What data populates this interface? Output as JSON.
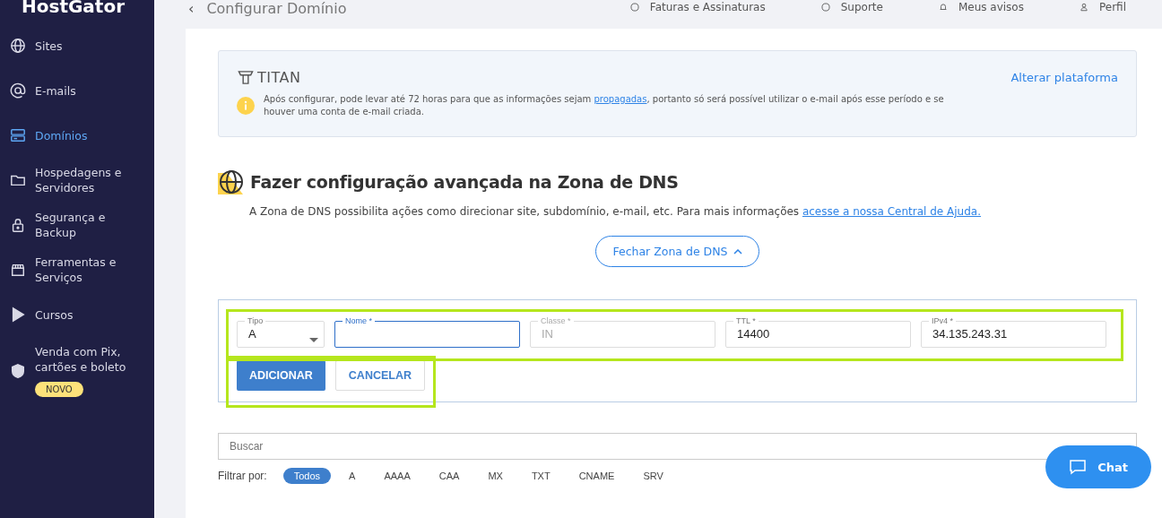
{
  "logo": "HostGator",
  "sidebar": {
    "items": [
      {
        "label": "Sites",
        "selected": false
      },
      {
        "label": "E-mails",
        "selected": false
      },
      {
        "label": "Domínios",
        "selected": true
      },
      {
        "label": "Hospedagens e Servidores",
        "selected": false
      },
      {
        "label": "Segurança e Backup",
        "selected": false
      },
      {
        "label": "Ferramentas e Serviços",
        "selected": false
      },
      {
        "label": "Cursos",
        "selected": false
      },
      {
        "label": "Venda com Pix, cartões e boleto",
        "selected": false,
        "badge": "NOVO"
      }
    ]
  },
  "header": {
    "back": "‹",
    "title": "Configurar Domínio",
    "links": [
      {
        "label": "Faturas e Assinaturas"
      },
      {
        "label": "Suporte"
      },
      {
        "label": "Meus avisos"
      },
      {
        "label": "Perfil"
      }
    ]
  },
  "email_card": {
    "provider": "TITAN",
    "action": "Alterar plataforma",
    "notice_before": "Após configurar, pode levar até 72 horas para que as informações sejam ",
    "notice_link": "propagadas",
    "notice_after": ", portanto só será possível utilizar o e-mail após esse período e se houver uma conta de e-mail criada."
  },
  "dns": {
    "title": "Fazer configuração avançada na Zona de DNS",
    "description": "A Zona de DNS possibilita ações como direcionar site, subdomínio, e-mail, etc. Para mais informações ",
    "help_link": "acesse a nossa Central de Ajuda.",
    "toggle": "Fechar Zona de DNS",
    "fields": [
      {
        "kind": "select",
        "label": "Tipo",
        "value": "A",
        "focused": false,
        "disabled": false
      },
      {
        "kind": "input",
        "label": "Nome *",
        "focused": true,
        "disabled": false
      },
      {
        "kind": "input",
        "label": "Classe *",
        "value": "IN",
        "focused": false,
        "disabled": true
      },
      {
        "kind": "input",
        "label": "TTL *",
        "value": "14400",
        "focused": false,
        "disabled": false
      },
      {
        "kind": "input",
        "label": "IPv4 *",
        "value": "34.135.243.31",
        "focused": false,
        "disabled": false
      }
    ],
    "buttons": [
      {
        "kind": "primary",
        "label": "ADICIONAR"
      },
      {
        "kind": "secondary",
        "label": "CANCELAR"
      }
    ],
    "search": {
      "placeholder": "Buscar"
    },
    "filter_label": "Filtrar por:",
    "filters": [
      {
        "label": "Todos",
        "selected": true
      },
      {
        "label": "A",
        "selected": false
      },
      {
        "label": "AAAA",
        "selected": false
      },
      {
        "label": "CAA",
        "selected": false
      },
      {
        "label": "MX",
        "selected": false
      },
      {
        "label": "TXT",
        "selected": false
      },
      {
        "label": "CNAME",
        "selected": false
      },
      {
        "label": "SRV",
        "selected": false
      }
    ]
  },
  "chat": {
    "label": "Chat"
  }
}
